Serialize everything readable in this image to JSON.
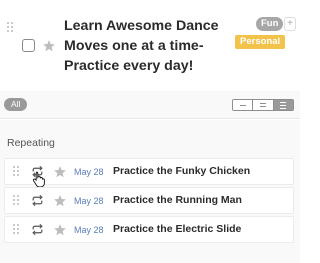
{
  "task": {
    "title": "Learn Awesome Dance Moves one at a time- Practice every day!",
    "tags": [
      {
        "label": "Fun",
        "color": "#a7a7a7"
      },
      {
        "label": "Personal",
        "color": "#f2c24b"
      }
    ],
    "close_glyph": "+"
  },
  "filter": {
    "all_label": "All",
    "view_options": [
      "list-view",
      "compact-view",
      "detailed-view"
    ],
    "active_view": "detailed-view"
  },
  "repeating": {
    "section_label": "Repeating",
    "items": [
      {
        "date": "May 28",
        "title": "Practice the Funky Chicken"
      },
      {
        "date": "May 28",
        "title": "Practice the Running Man"
      },
      {
        "date": "May 28",
        "title": "Practice the Electric Slide"
      }
    ]
  },
  "colors": {
    "date_blue": "#5a7fb8",
    "tag_personal": "#f2c24b",
    "tag_fun": "#a7a7a7",
    "star_gray": "#bdbdbd"
  }
}
